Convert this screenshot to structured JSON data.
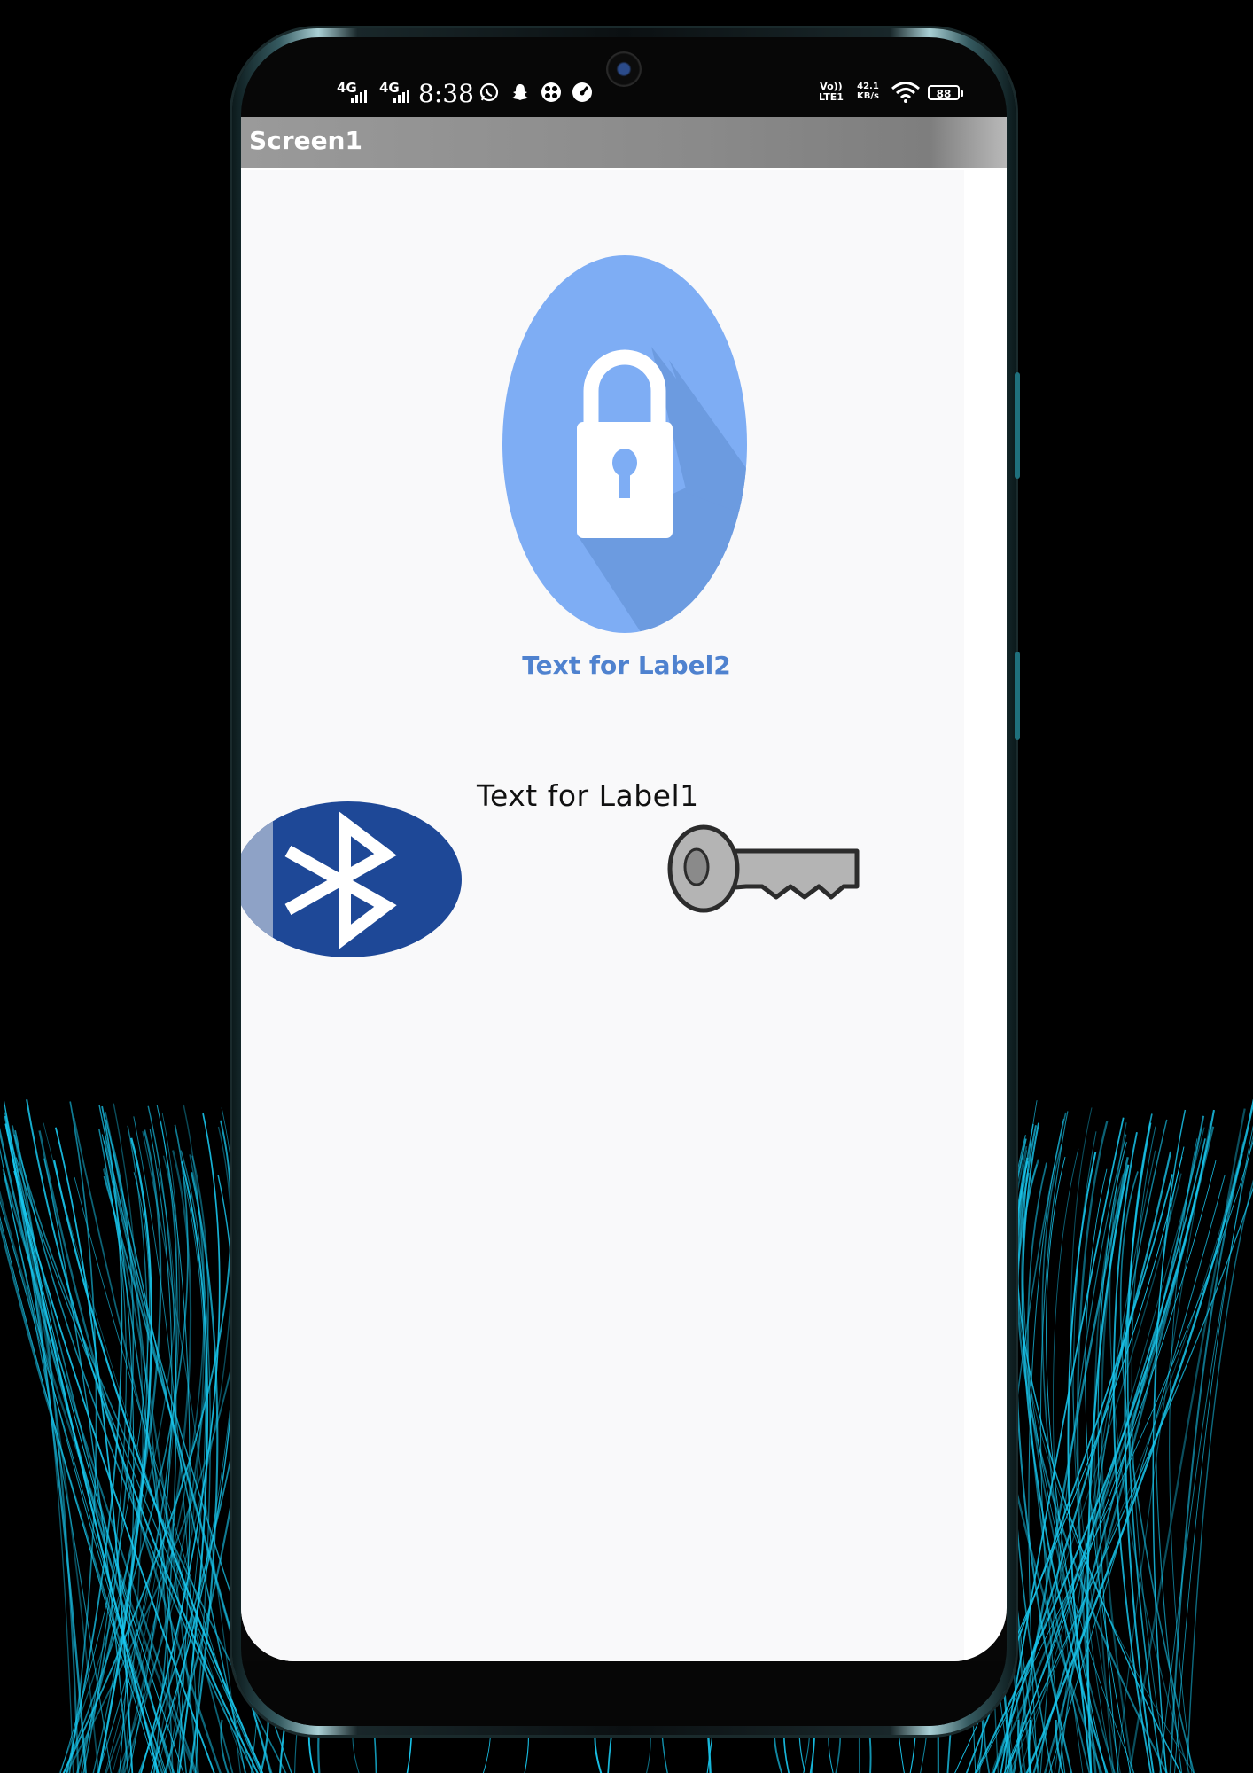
{
  "status_bar": {
    "network_1": "4G",
    "network_2": "4G",
    "time": "8:38",
    "volte_top": "Vo))",
    "volte_bottom": "LTE1",
    "speed_value": "42.1",
    "speed_unit": "KB/s",
    "battery": "88",
    "icons": [
      "whatsapp-icon",
      "snapchat-icon",
      "app-icon",
      "gauge-icon",
      "wifi-icon"
    ]
  },
  "app": {
    "title": "Screen1"
  },
  "content": {
    "label2": "Text for Label2",
    "label1": "Text for Label1",
    "images": [
      "lock-icon",
      "bluetooth-icon",
      "key-icon"
    ]
  },
  "colors": {
    "label2_text": "#4f82cf",
    "lock_circle": "#7eadf4",
    "bluetooth_bg": "#1e4897",
    "title_bar": "#8c8c8c",
    "screen_bg": "#f9f9fa",
    "backdrop_lines": "#19c8ef"
  }
}
